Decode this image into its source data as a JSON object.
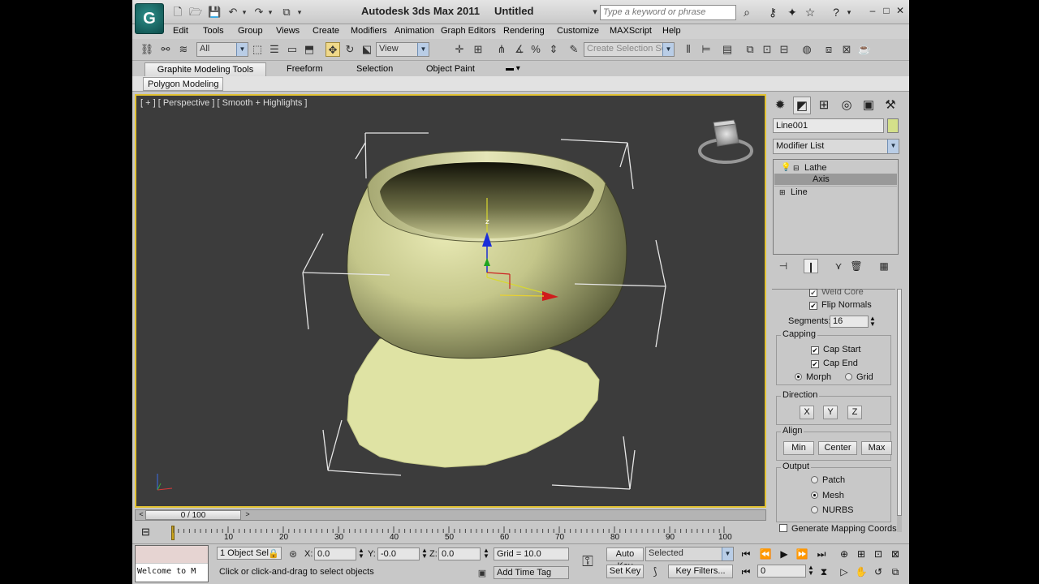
{
  "titlebar": {
    "app_title": "Autodesk 3ds Max  2011",
    "doc_title": "Untitled",
    "search_placeholder": "Type a keyword or phrase"
  },
  "menu": [
    "Edit",
    "Tools",
    "Group",
    "Views",
    "Create",
    "Modifiers",
    "Animation",
    "Graph Editors",
    "Rendering",
    "Customize",
    "MAXScript",
    "Help"
  ],
  "toolbar": {
    "selection_filter": "All",
    "ref_coord": "View",
    "named_selection_placeholder": "Create Selection Se"
  },
  "ribbon": {
    "tabs": [
      "Graphite Modeling Tools",
      "Freeform",
      "Selection",
      "Object Paint"
    ],
    "panel_button": "Polygon Modeling"
  },
  "viewport": {
    "label": "[ + ] [ Perspective ] [ Smooth + Highlights ]",
    "gizmo_axis_label": "z",
    "object_color": "#d8dc9a"
  },
  "command_panel": {
    "object_name": "Line001",
    "object_color": "#d4e08a",
    "modifier_list": "Modifier List",
    "stack": [
      {
        "label": "Lathe",
        "selected": false
      },
      {
        "label": "Axis",
        "selected": true
      },
      {
        "label": "Line",
        "selected": false
      }
    ],
    "params": {
      "weld_core": "Weld Core",
      "flip_normals": "Flip Normals",
      "segments_label": "Segments:",
      "segments_value": "16",
      "capping_title": "Capping",
      "cap_start": "Cap Start",
      "cap_end": "Cap End",
      "morph": "Morph",
      "grid": "Grid",
      "direction_title": "Direction",
      "dir_x": "X",
      "dir_y": "Y",
      "dir_z": "Z",
      "align_title": "Align",
      "align_min": "Min",
      "align_center": "Center",
      "align_max": "Max",
      "output_title": "Output",
      "patch": "Patch",
      "mesh": "Mesh",
      "nurbs": "NURBS",
      "gen_mapping": "Generate Mapping Coords."
    }
  },
  "timeline": {
    "frame_display": "0 / 100",
    "ticks": [
      "10",
      "20",
      "30",
      "40",
      "50",
      "60",
      "70",
      "80",
      "90",
      "100"
    ]
  },
  "status": {
    "maxscript_text": "Welcome to M",
    "selection_count": "1 Object Sel",
    "x_label": "X:",
    "x_value": "0.0",
    "y_label": "Y:",
    "y_value": "-0.0",
    "z_label": "Z:",
    "z_value": "0.0",
    "grid": "Grid = 10.0",
    "prompt": "Click or click-and-drag to select objects",
    "add_time_tag": "Add Time Tag",
    "auto_key": "Auto Key",
    "selected": "Selected",
    "set_key": "Set Key",
    "key_filters": "Key Filters...",
    "current_frame": "0"
  }
}
